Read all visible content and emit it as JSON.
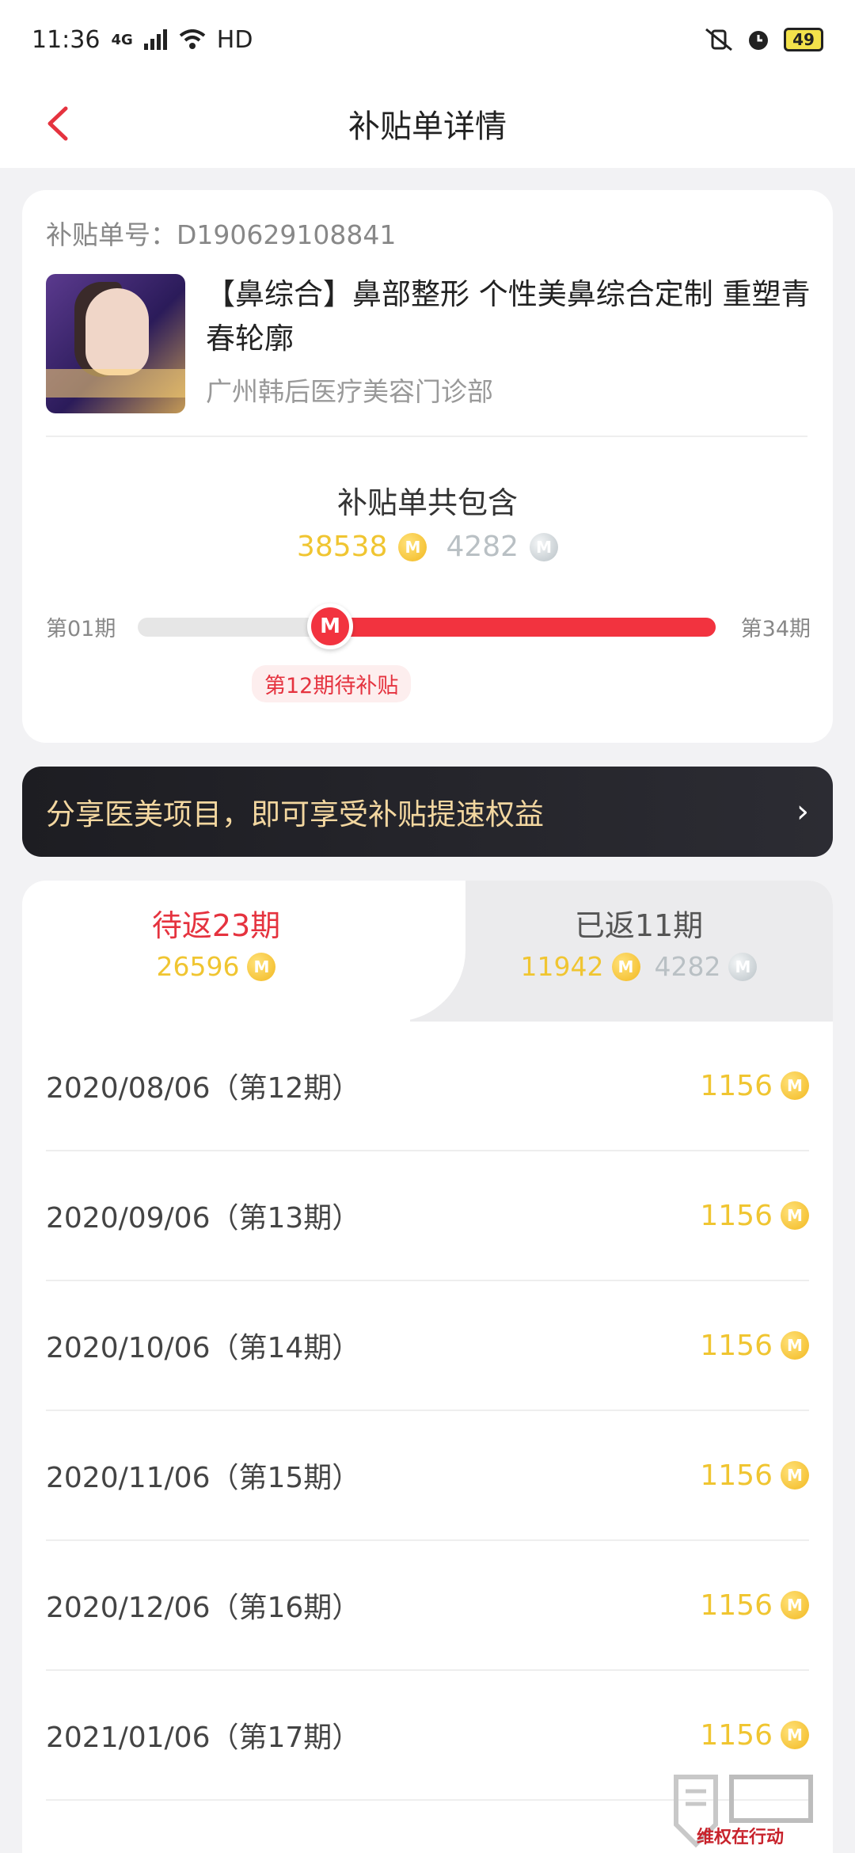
{
  "status_bar": {
    "time": "11:36",
    "network": "4G",
    "hd": "HD",
    "battery": "49"
  },
  "header": {
    "title": "补贴单详情"
  },
  "order": {
    "number_label": "补贴单号：D190629108841",
    "product_title": "【鼻综合】鼻部整形 个性美鼻综合定制 重塑青春轮廓",
    "hospital": "广州韩后医疗美容门诊部"
  },
  "summary": {
    "title": "补贴单共包含",
    "gold_total": "38538",
    "silver_total": "4282",
    "period_start": "第01期",
    "period_end": "第34期",
    "current_period": 12,
    "total_periods": 34,
    "pending_label": "第12期待补贴",
    "thumb_glyph": "M"
  },
  "share": {
    "text": "分享医美项目，即可享受补贴提速权益",
    "arrow": "›"
  },
  "tabs": {
    "pending": {
      "title": "待返23期",
      "gold": "26596"
    },
    "returned": {
      "title": "已返11期",
      "gold": "11942",
      "silver": "4282"
    }
  },
  "rows": [
    {
      "date": "2020/08/06（第12期）",
      "amount": "1156"
    },
    {
      "date": "2020/09/06（第13期）",
      "amount": "1156"
    },
    {
      "date": "2020/10/06（第14期）",
      "amount": "1156"
    },
    {
      "date": "2020/11/06（第15期）",
      "amount": "1156"
    },
    {
      "date": "2020/12/06（第16期）",
      "amount": "1156"
    },
    {
      "date": "2021/01/06（第17期）",
      "amount": "1156"
    }
  ],
  "coin_glyph": "M",
  "watermark": "维权在行动",
  "colors": {
    "accent_red": "#f2333f",
    "gold": "#f0c531",
    "silver": "#b9c0c4"
  }
}
